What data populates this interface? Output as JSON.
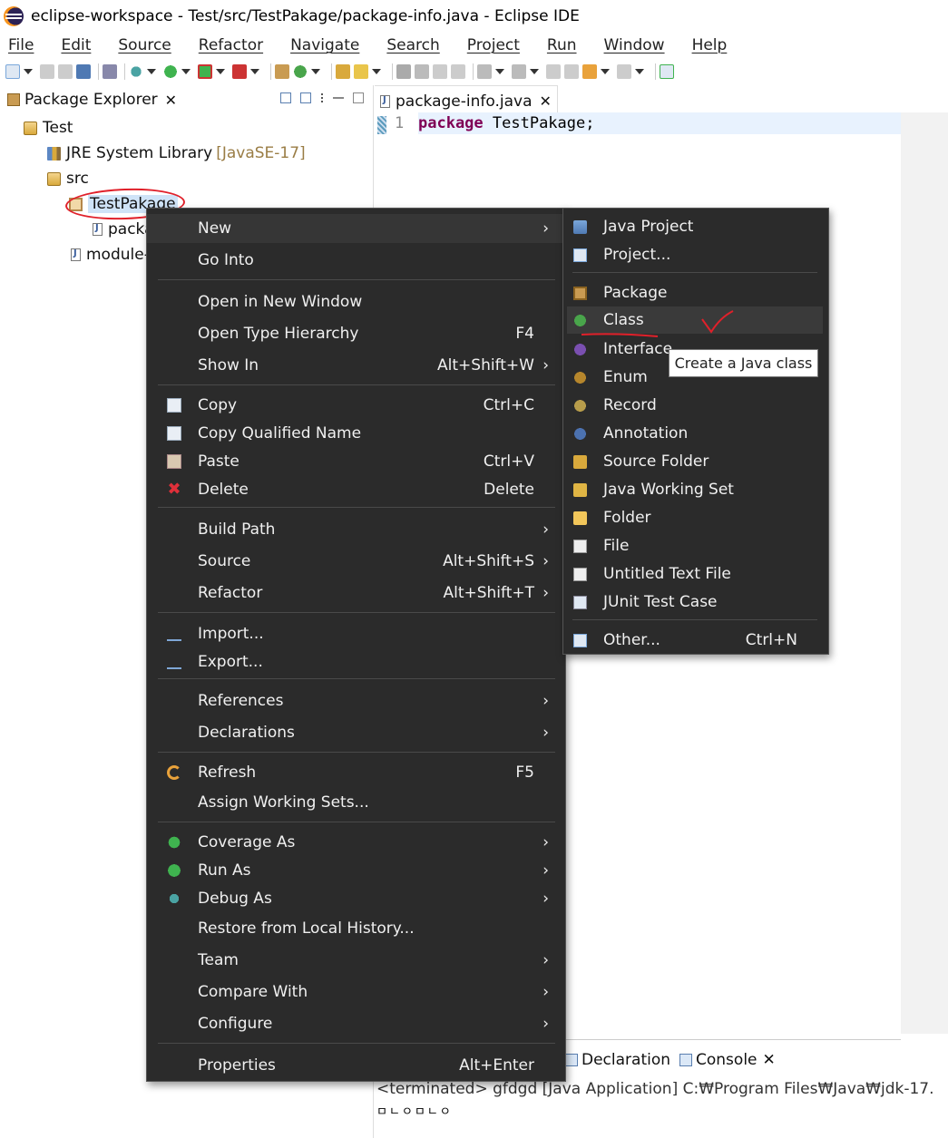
{
  "window": {
    "title": "eclipse-workspace - Test/src/TestPakage/package-info.java - Eclipse IDE"
  },
  "menubar": [
    "File",
    "Edit",
    "Source",
    "Refactor",
    "Navigate",
    "Search",
    "Project",
    "Run",
    "Window",
    "Help"
  ],
  "package_explorer": {
    "tab_label": "Package Explorer",
    "close": "✕",
    "tree": {
      "project": "Test",
      "jre": "JRE System Library",
      "jre_version": "[JavaSE-17]",
      "src": "src",
      "package": "TestPakage",
      "file_truncated": "packa",
      "module_truncated": "module-"
    }
  },
  "editor": {
    "tab_label": "package-info.java",
    "close": "✕",
    "line_number": "1",
    "code_keyword": "package",
    "code_rest": " TestPakage;"
  },
  "console": {
    "tab_declaration": "Declaration",
    "tab_console": "Console",
    "close": "✕",
    "status": "<terminated> gfdgd [Java Application] C:₩Program Files₩Java₩jdk-17.",
    "output": "ㅁㄴㅇㅁㄴㅇ"
  },
  "context_menu": {
    "new": "New",
    "go_into": "Go Into",
    "open_new_window": "Open in New Window",
    "open_type_hierarchy": "Open Type Hierarchy",
    "open_type_hierarchy_sc": "F4",
    "show_in": "Show In",
    "show_in_sc": "Alt+Shift+W",
    "copy": "Copy",
    "copy_sc": "Ctrl+C",
    "copy_qualified": "Copy Qualified Name",
    "paste": "Paste",
    "paste_sc": "Ctrl+V",
    "delete": "Delete",
    "delete_sc": "Delete",
    "build_path": "Build Path",
    "source": "Source",
    "source_sc": "Alt+Shift+S",
    "refactor": "Refactor",
    "refactor_sc": "Alt+Shift+T",
    "import": "Import...",
    "export": "Export...",
    "references": "References",
    "declarations": "Declarations",
    "refresh": "Refresh",
    "refresh_sc": "F5",
    "assign_working_sets": "Assign Working Sets...",
    "coverage_as": "Coverage As",
    "run_as": "Run As",
    "debug_as": "Debug As",
    "restore_history": "Restore from Local History...",
    "team": "Team",
    "compare_with": "Compare With",
    "configure": "Configure",
    "properties": "Properties",
    "properties_sc": "Alt+Enter",
    "arrow": "›"
  },
  "submenu": {
    "java_project": "Java Project",
    "project": "Project...",
    "package": "Package",
    "class": "Class",
    "interface": "Interface",
    "enum": "Enum",
    "record": "Record",
    "annotation": "Annotation",
    "source_folder": "Source Folder",
    "java_working_set": "Java Working Set",
    "folder": "Folder",
    "file": "File",
    "untitled_text_file": "Untitled Text File",
    "junit_test_case": "JUnit Test Case",
    "other": "Other...",
    "other_sc": "Ctrl+N"
  },
  "tooltip": "Create a Java class",
  "annotation_color": "#e0202a"
}
